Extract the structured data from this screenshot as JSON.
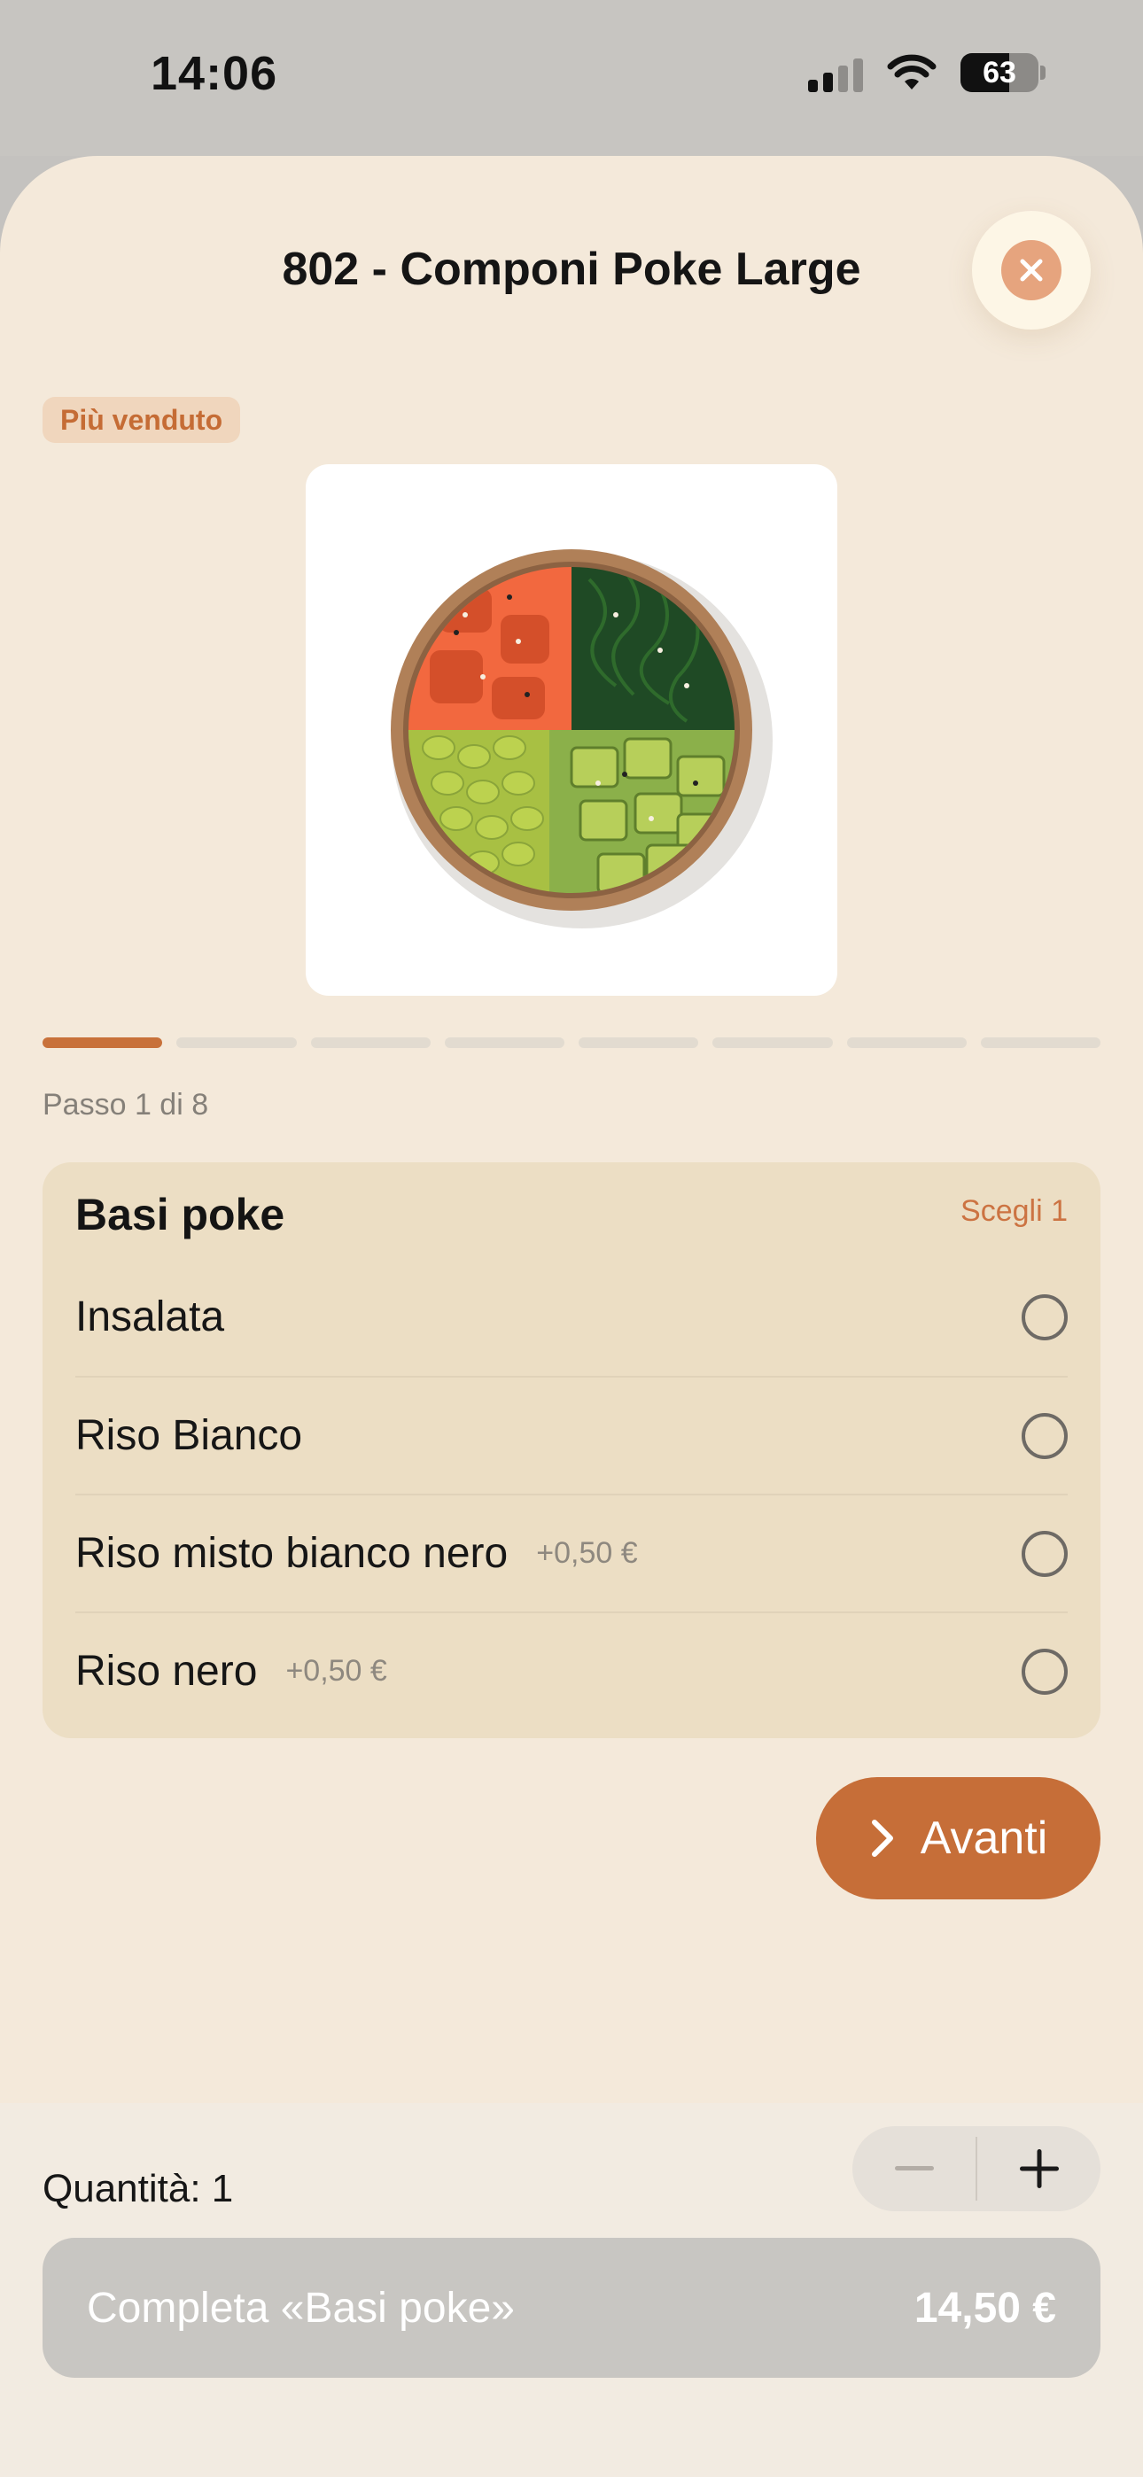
{
  "status_bar": {
    "time": "14:06",
    "battery": "63"
  },
  "sheet": {
    "title": "802 - Componi Poke Large",
    "badge": "Più venduto",
    "step": {
      "label": "Passo 1 di 8",
      "current": 1,
      "total": 8
    }
  },
  "options_card": {
    "title": "Basi poke",
    "hint": "Scegli 1",
    "options": [
      {
        "label": "Insalata",
        "price": ""
      },
      {
        "label": "Riso Bianco",
        "price": ""
      },
      {
        "label": "Riso misto bianco nero",
        "price": "+0,50 €"
      },
      {
        "label": "Riso nero",
        "price": "+0,50 €"
      }
    ]
  },
  "next_button": {
    "label": "Avanti"
  },
  "footer": {
    "quantity_label": "Quantità: 1",
    "complete_label": "Completa «Basi poke»",
    "complete_price": "14,50 €"
  },
  "colors": {
    "accent": "#c66e38",
    "sheet_bg": "#f4e9da",
    "card_bg": "#ecdec4"
  },
  "icons": {
    "close": "close-icon",
    "next": "chevron-right-icon",
    "minus": "minus-icon",
    "plus": "plus-icon"
  }
}
